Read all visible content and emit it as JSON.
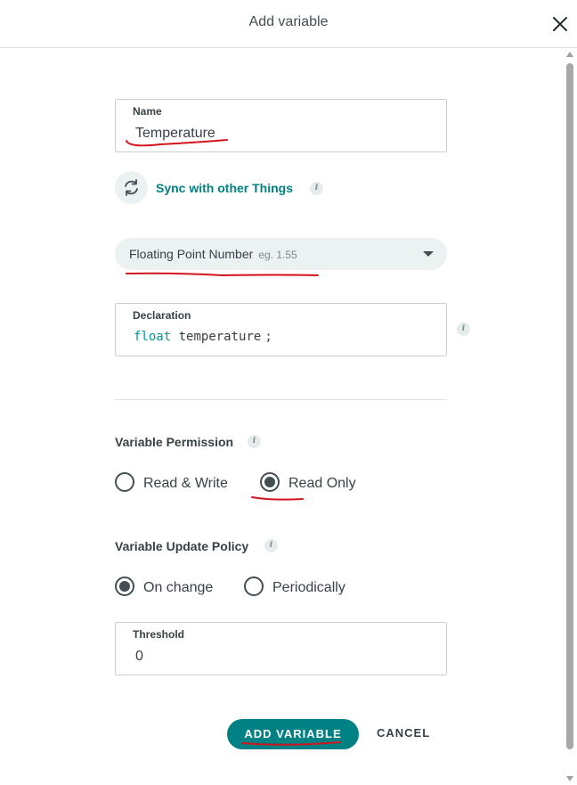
{
  "header": {
    "title": "Add variable"
  },
  "name_field": {
    "label": "Name",
    "value": "Temperature"
  },
  "sync": {
    "label": "Sync with other Things",
    "info_icon": "info-icon"
  },
  "type_select": {
    "value": "Floating Point Number",
    "hint": "eg. 1.55"
  },
  "declaration": {
    "label": "Declaration",
    "type_keyword": "float",
    "identifier": "temperature",
    "terminator": ";"
  },
  "permission": {
    "title": "Variable Permission",
    "options": [
      {
        "label": "Read & Write",
        "checked": false
      },
      {
        "label": "Read Only",
        "checked": true
      }
    ]
  },
  "update_policy": {
    "title": "Variable Update Policy",
    "options": [
      {
        "label": "On change",
        "checked": true
      },
      {
        "label": "Periodically",
        "checked": false
      }
    ]
  },
  "threshold": {
    "label": "Threshold",
    "value": "0"
  },
  "actions": {
    "add_label": "ADD VARIABLE",
    "cancel_label": "CANCEL"
  },
  "colors": {
    "accent": "#008184",
    "annotation": "#d4141c",
    "text": "#374146"
  }
}
